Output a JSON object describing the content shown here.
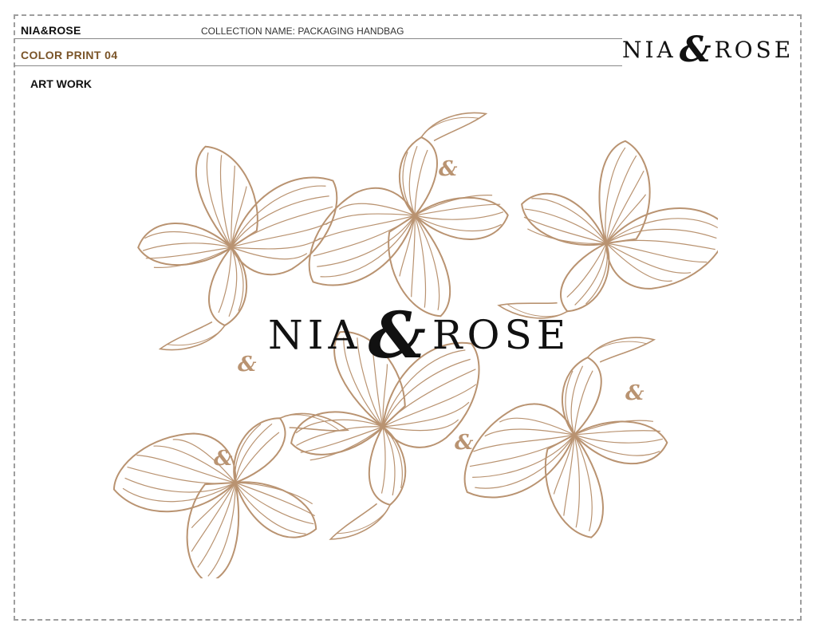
{
  "header": {
    "brand": "NIA&ROSE",
    "collection_name": "COLLECTION NAME: PACKAGING HANDBAG",
    "color_print": "COLOR PRINT 04",
    "section_title": "ART WORK"
  },
  "logo": {
    "word_left": "NIA",
    "ampersand": "&",
    "word_right": "ROSE"
  },
  "artwork": {
    "motif": "line-art calla lily flowers with small ampersand marks",
    "line_color": "#b99371"
  },
  "colors": {
    "accent_text": "#7a5428",
    "logo": "#111111"
  }
}
